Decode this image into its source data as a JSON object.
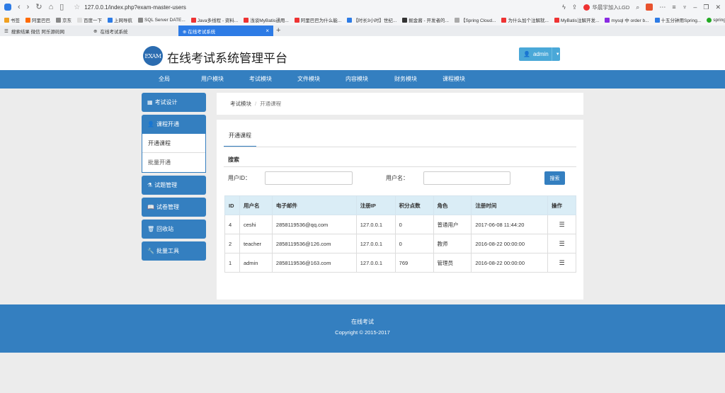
{
  "browser": {
    "url": "127.0.0.1/index.php?exam-master-users",
    "search_text": "华晨宇加入LGD",
    "bookmarks": [
      "书签",
      "阿里巴巴",
      "京东",
      "百度一下",
      "上网导航",
      "SQL Server DATE...",
      "Java多线程 - 资料...",
      "浅谈MyBatis通用...",
      "阿里巴巴为什么能...",
      "【时长3小时】世纪...",
      "掘金酱 - 开发者的...",
      "【Spring Cloud...",
      "为什么加个注解就...",
      "MyBatis注解开发...",
      "mysql 中 order b...",
      "十五分钟用Spring...",
      "spring"
    ],
    "tabs": [
      "搜索结果 微信 阿乐源码网",
      "在线考试系统",
      "在线考试系统"
    ]
  },
  "header": {
    "logo": "EXAM",
    "title": "在线考试系统管理平台",
    "user": "admin"
  },
  "nav": [
    "全局",
    "用户模块",
    "考试模块",
    "文件模块",
    "内容模块",
    "财务模块",
    "课程模块"
  ],
  "sidebar": {
    "design": "考试设计",
    "course_open": "课程开通",
    "sub": [
      "开通课程",
      "批量开通"
    ],
    "question": "试题管理",
    "paper": "试卷管理",
    "recycle": "回收站",
    "batch": "批量工具"
  },
  "breadcrumb": {
    "parent": "考试模块",
    "sep": "/",
    "current": "开通课程"
  },
  "main": {
    "tab": "开通课程",
    "search_title": "搜索",
    "uid_label": "用户ID：",
    "uname_label": "用户名：",
    "search_button": "搜索"
  },
  "table": {
    "headers": [
      "ID",
      "用户名",
      "电子邮件",
      "注册IP",
      "积分点数",
      "角色",
      "注册时间",
      "操作"
    ],
    "rows": [
      [
        "4",
        "ceshi",
        "2858119536@qq.com",
        "127.0.0.1",
        "0",
        "普通用户",
        "2017-06-08 11:44:20"
      ],
      [
        "2",
        "teacher",
        "2858119536@126.com",
        "127.0.0.1",
        "0",
        "教师",
        "2016-08-22 00:00:00"
      ],
      [
        "1",
        "admin",
        "2858119536@163.com",
        "127.0.0.1",
        "769",
        "管理员",
        "2016-08-22 00:00:00"
      ]
    ]
  },
  "footer": {
    "name": "在线考试",
    "copyright": "Copyright © 2015-2017"
  },
  "colors": {
    "primary": "#347fc0",
    "header_bg": "#daedf6",
    "user_btn": "#4aa8d8"
  }
}
